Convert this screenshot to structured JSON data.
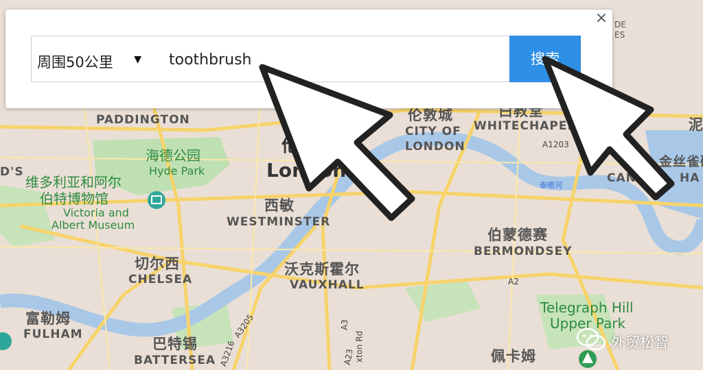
{
  "search_panel": {
    "range_value": "周围50公里",
    "query_value": "toothbrush",
    "search_label": "搜索",
    "close_glyph": "×"
  },
  "map": {
    "places": {
      "paddington": "PADDINGTON",
      "hyde_park_cn": "海德公园",
      "hyde_park_en": "Hyde Park",
      "va_cn_1": "维多利亚和阿尔",
      "va_cn_2": "伯特博物馆",
      "va_en_1": "Victoria and",
      "va_en_2": "Albert Museum",
      "london_cn": "伦",
      "london_en": "London",
      "westminster_cn": "西敏",
      "westminster_en": "WESTMINSTER",
      "city_cn": "伦敦城",
      "city_en_1": "CITY OF",
      "city_en_2": "LONDON",
      "whitechapel_cn": "白教堂",
      "whitechapel_en": "WHITECHAPEL",
      "chelsea_cn": "切尔西",
      "chelsea_en": "CHELSEA",
      "vauxhall_cn": "沃克斯霍尔",
      "vauxhall_en": "VAUXHALL",
      "bermondsey_cn": "伯蒙德赛",
      "bermondsey_en": "BERMONDSEY",
      "fulham_cn": "富勒姆",
      "fulham_en": "FULHAM",
      "battersea_cn": "巴特锡",
      "battersea_en": "BATTERSEA",
      "peckham_cn": "佩卡姆",
      "telegraph_en_1": "Telegraph Hill",
      "telegraph_en_2": "Upper Park",
      "thames_cn": "泰晤河",
      "canary_cn": "金丝雀码",
      "canary_en": "CANA",
      "canary_en_2": "HA",
      "edge_cn": "泥",
      "edge_en_left": "D'S",
      "edge_en_top": "DE",
      "edge_en_top2": "ES"
    },
    "roads": {
      "a1203": "A1203",
      "a2": "A2",
      "a3": "A3",
      "a3205": "A3205",
      "a3216": "A3216",
      "a23": "A23",
      "kennington": "xton Rd"
    }
  },
  "watermark": {
    "text": "外贸松智"
  },
  "colors": {
    "accent": "#2e8fe6",
    "map_land": "#eadfd6",
    "water": "#a9c8e8",
    "park": "#bfe0b3",
    "road": "#f7d36a"
  }
}
